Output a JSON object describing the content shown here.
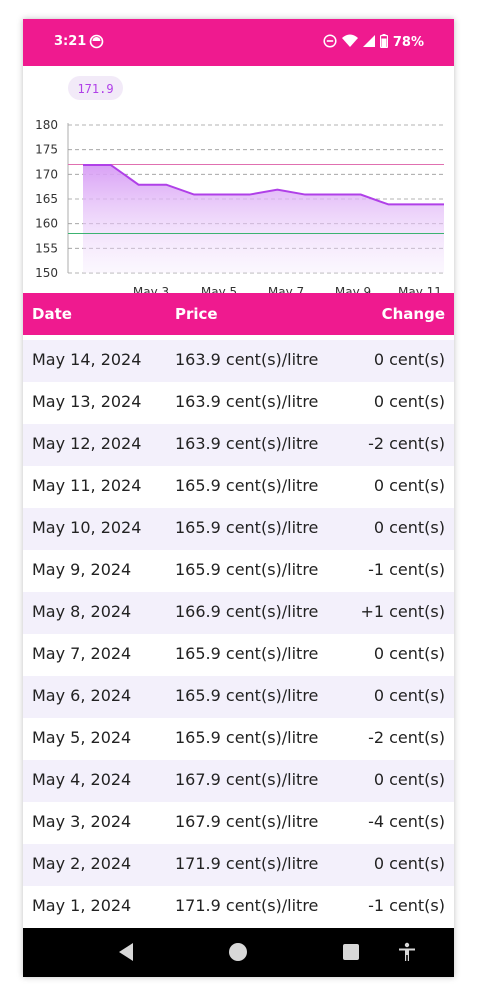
{
  "status_bar": {
    "time": "3:21",
    "battery": "78%",
    "icons": [
      "face-icon",
      "do-not-disturb-icon",
      "wifi-icon",
      "signal-icon",
      "battery-icon"
    ]
  },
  "chart": {
    "tooltip": "171.9",
    "y_ticks": [
      "180",
      "175",
      "170",
      "165",
      "160",
      "155",
      "150"
    ],
    "x_ticks": [
      "...",
      "May 3",
      "May 5",
      "May 7",
      "May 9",
      "May 11"
    ]
  },
  "chart_data": {
    "type": "area",
    "x": [
      "May 1",
      "May 2",
      "May 3",
      "May 4",
      "May 5",
      "May 6",
      "May 7",
      "May 8",
      "May 9",
      "May 10",
      "May 11",
      "May 12",
      "May 13",
      "May 14"
    ],
    "values": [
      171.9,
      171.9,
      167.9,
      167.9,
      165.9,
      165.9,
      165.9,
      166.9,
      165.9,
      165.9,
      165.9,
      163.9,
      163.9,
      163.9
    ],
    "ylim": [
      150,
      180
    ],
    "reference_lines": [
      172,
      158
    ],
    "grid": true,
    "colors": {
      "line": "#b040e8",
      "fill_top": "#d79cf5",
      "high_line": "#e070b0",
      "low_line": "#3cb371"
    }
  },
  "table": {
    "headers": {
      "date": "Date",
      "price": "Price",
      "change": "Change"
    },
    "rows": [
      {
        "date": "May 14, 2024",
        "price": "163.9 cent(s)/litre",
        "change": "0 cent(s)"
      },
      {
        "date": "May 13, 2024",
        "price": "163.9 cent(s)/litre",
        "change": "0 cent(s)"
      },
      {
        "date": "May 12, 2024",
        "price": "163.9 cent(s)/litre",
        "change": "-2 cent(s)"
      },
      {
        "date": "May 11, 2024",
        "price": "165.9 cent(s)/litre",
        "change": "0 cent(s)"
      },
      {
        "date": "May 10, 2024",
        "price": "165.9 cent(s)/litre",
        "change": "0 cent(s)"
      },
      {
        "date": "May 9, 2024",
        "price": "165.9 cent(s)/litre",
        "change": "-1 cent(s)"
      },
      {
        "date": "May 8, 2024",
        "price": "166.9 cent(s)/litre",
        "change": "+1 cent(s)"
      },
      {
        "date": "May 7, 2024",
        "price": "165.9 cent(s)/litre",
        "change": "0 cent(s)"
      },
      {
        "date": "May 6, 2024",
        "price": "165.9 cent(s)/litre",
        "change": "0 cent(s)"
      },
      {
        "date": "May 5, 2024",
        "price": "165.9 cent(s)/litre",
        "change": "-2 cent(s)"
      },
      {
        "date": "May 4, 2024",
        "price": "167.9 cent(s)/litre",
        "change": "0 cent(s)"
      },
      {
        "date": "May 3, 2024",
        "price": "167.9 cent(s)/litre",
        "change": "-4 cent(s)"
      },
      {
        "date": "May 2, 2024",
        "price": "171.9 cent(s)/litre",
        "change": "0 cent(s)"
      },
      {
        "date": "May 1, 2024",
        "price": "171.9 cent(s)/litre",
        "change": "-1 cent(s)"
      }
    ]
  },
  "nav_bar": {
    "buttons": [
      "back-icon",
      "home-icon",
      "recents-icon",
      "accessibility-icon"
    ]
  },
  "colors": {
    "accent": "#ef1a8f",
    "row_alt": "#f3f0fb"
  }
}
